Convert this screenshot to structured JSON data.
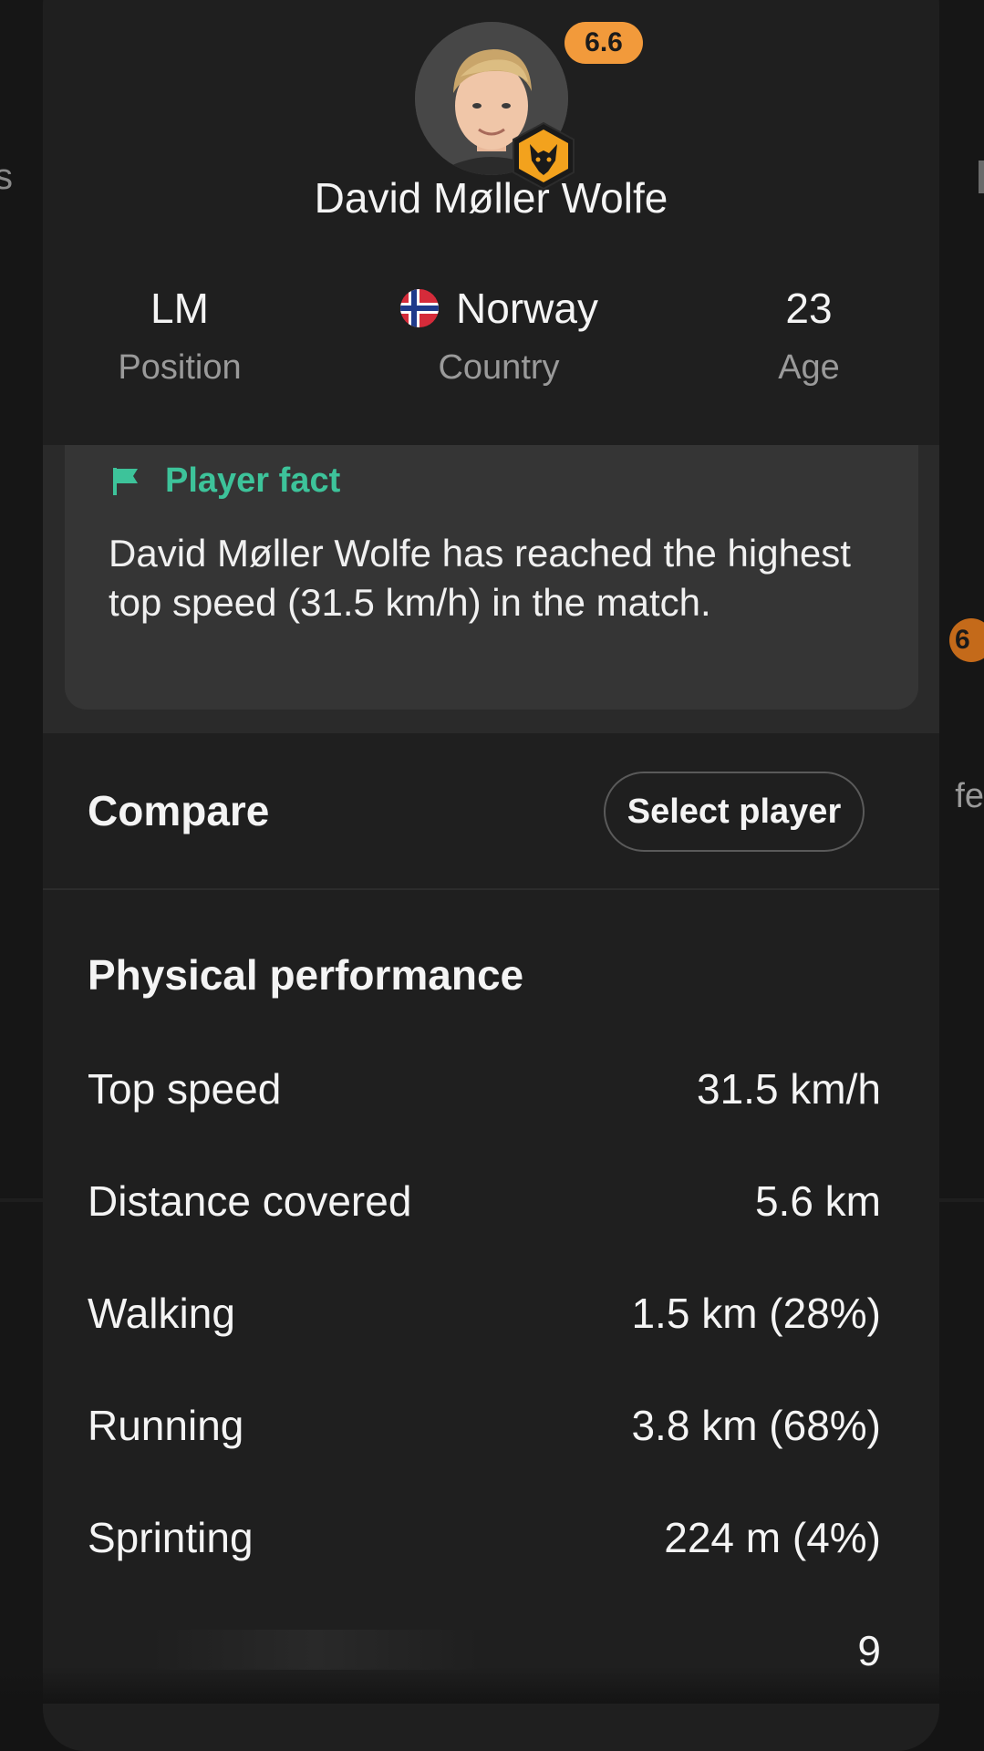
{
  "background": {
    "left_fragment": "s",
    "right_fragment": "fe",
    "right_badge": "6"
  },
  "player": {
    "name": "David Møller Wolfe",
    "rating": "6.6",
    "club_icon": "wolves-crest-icon",
    "rating_color": "#f29a3b"
  },
  "info": {
    "position_value": "LM",
    "position_label": "Position",
    "country_value": "Norway",
    "country_label": "Country",
    "country_flag_icon": "norway-flag-icon",
    "age_value": "23",
    "age_label": "Age"
  },
  "fact": {
    "title": "Player fact",
    "icon": "flag-icon",
    "text": "David Møller Wolfe has reached the highest top speed (31.5 km/h) in the match.",
    "accent_color": "#3dc39a"
  },
  "compare": {
    "title": "Compare",
    "button_label": "Select player"
  },
  "physical": {
    "title": "Physical performance",
    "rows": [
      {
        "label": "Top speed",
        "value": "31.5 km/h"
      },
      {
        "label": "Distance covered",
        "value": "5.6 km"
      },
      {
        "label": "Walking",
        "value": "1.5 km (28%)"
      },
      {
        "label": "Running",
        "value": "3.8 km (68%)"
      },
      {
        "label": "Sprinting",
        "value": "224 m (4%)"
      }
    ],
    "partial_value": "9"
  }
}
